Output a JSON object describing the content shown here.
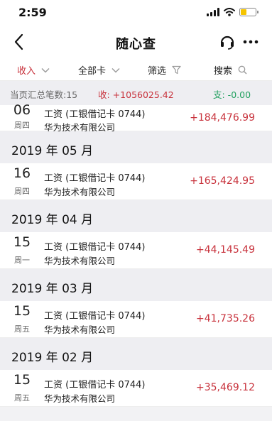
{
  "status_bar": {
    "time": "2:59",
    "icons": [
      "signal-icon",
      "wifi-icon",
      "battery-icon"
    ],
    "battery_color": "#f5c400"
  },
  "nav": {
    "title": "随心查",
    "back_icon": "chevron-left-icon",
    "service_icon": "headset-icon",
    "more_icon": "more-dots-icon"
  },
  "filters": {
    "income": "收入",
    "all_cards": "全部卡",
    "filter": "筛选",
    "search": "搜索"
  },
  "summary": {
    "count_text": "当页汇总笔数:15",
    "income_text": "收: +1056025.42",
    "expense_text": "支: -0.00"
  },
  "first_transaction": {
    "day": "06",
    "weekday": "周四",
    "desc": "工资 (工银借记卡 0744)",
    "company": "华为技术有限公司",
    "amount": "+184,476.99"
  },
  "months": [
    {
      "label": "2019 年 05 月",
      "transaction": {
        "day": "16",
        "weekday": "周四",
        "desc": "工资 (工银借记卡 0744)",
        "company": "华为技术有限公司",
        "amount": "+165,424.95"
      }
    },
    {
      "label": "2019 年 04 月",
      "transaction": {
        "day": "15",
        "weekday": "周一",
        "desc": "工资 (工银借记卡 0744)",
        "company": "华为技术有限公司",
        "amount": "+44,145.49"
      }
    },
    {
      "label": "2019 年 03 月",
      "transaction": {
        "day": "15",
        "weekday": "周五",
        "desc": "工资 (工银借记卡 0744)",
        "company": "华为技术有限公司",
        "amount": "+41,735.26"
      }
    },
    {
      "label": "2019 年 02 月",
      "transaction": {
        "day": "15",
        "weekday": "周五",
        "desc": "工资 (工银借记卡 0744)",
        "company": "华为技术有限公司",
        "amount": "+35,469.12"
      }
    }
  ],
  "colors": {
    "income": "#c8323c",
    "expense": "#23a060",
    "background": "#f2f2f4"
  }
}
